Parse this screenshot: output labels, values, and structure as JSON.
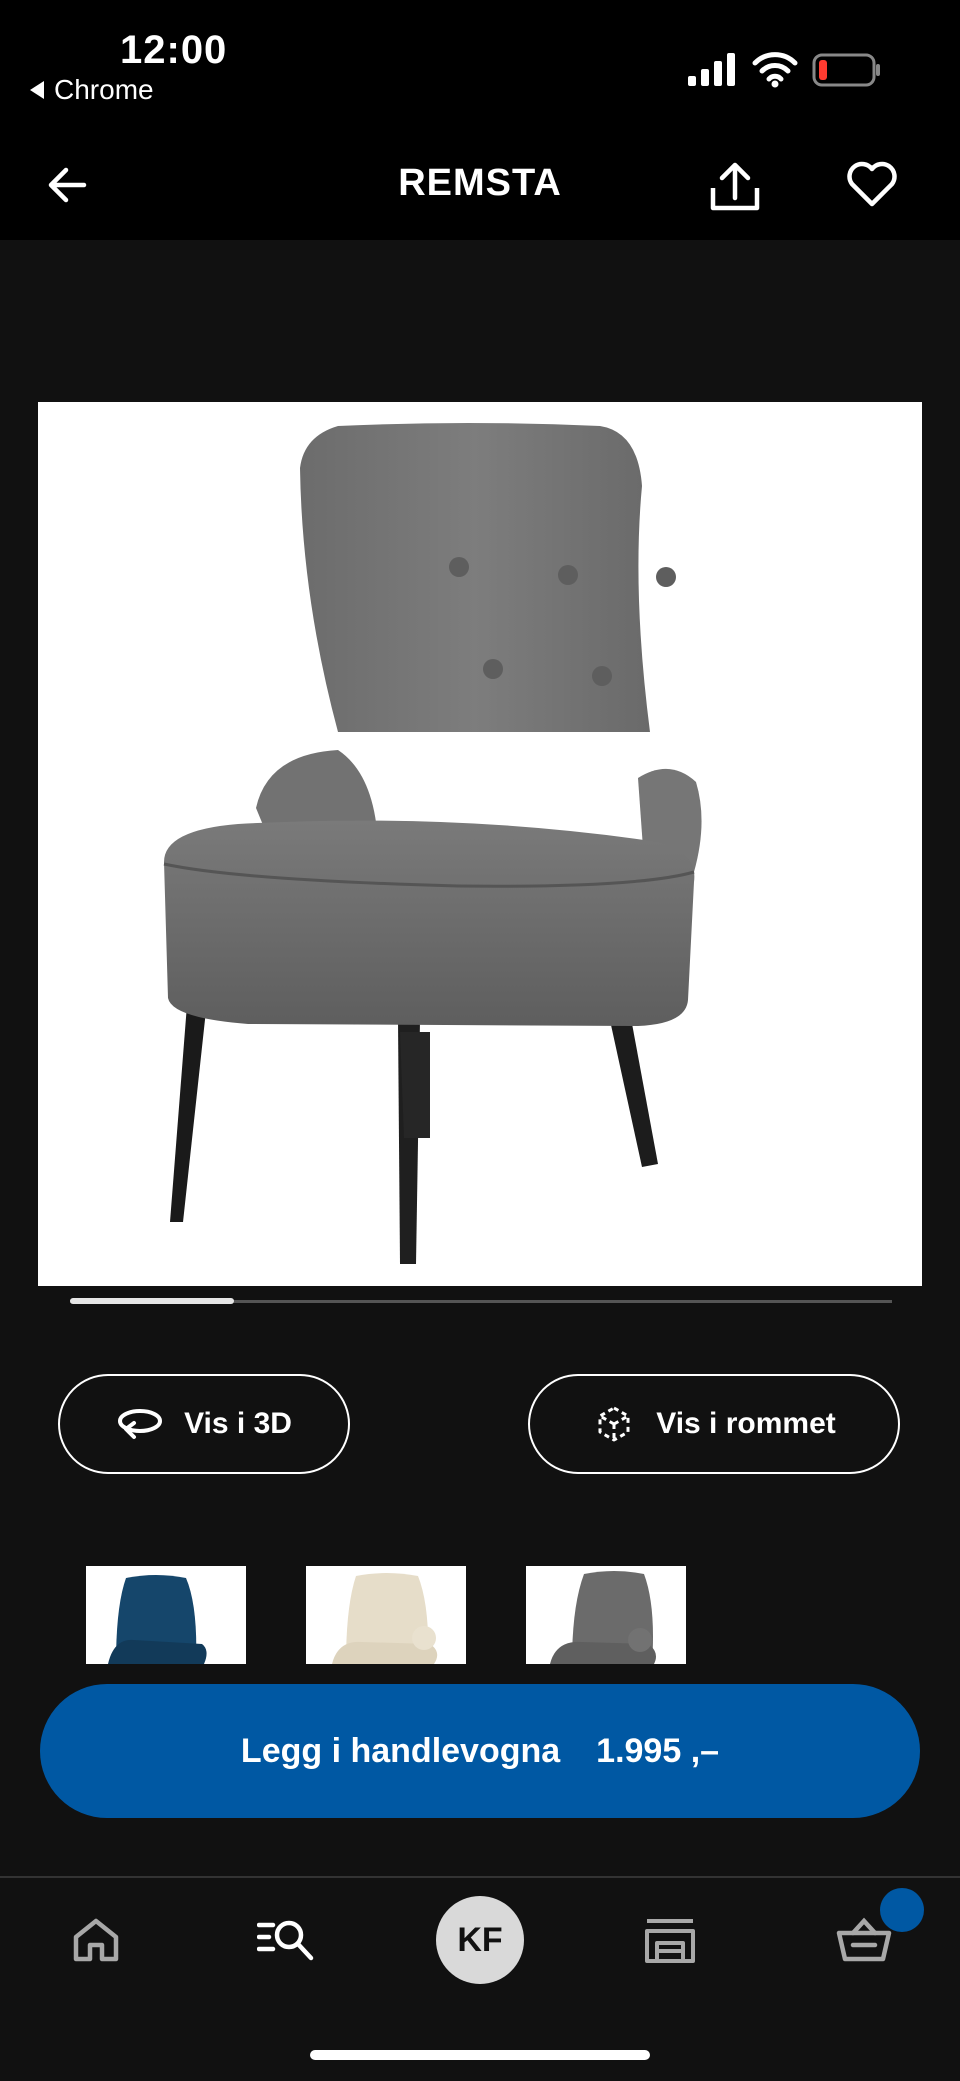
{
  "status_bar": {
    "time": "12:00",
    "back_app": "Chrome"
  },
  "header": {
    "title": "REMSTA"
  },
  "gallery": {
    "progress": 0.2
  },
  "actions": {
    "view_3d": "Vis i 3D",
    "view_in_room": "Vis i rommet"
  },
  "variants": [
    {
      "color": "#15466b"
    },
    {
      "color": "#e6ddc9"
    },
    {
      "color": "#6b6b6b"
    }
  ],
  "cart": {
    "label": "Legg i handlevogna",
    "price": "1.995 ,–"
  },
  "bottom_nav": {
    "avatar_initials": "KF"
  },
  "colors": {
    "accent": "#0058a3",
    "background": "#111111"
  }
}
